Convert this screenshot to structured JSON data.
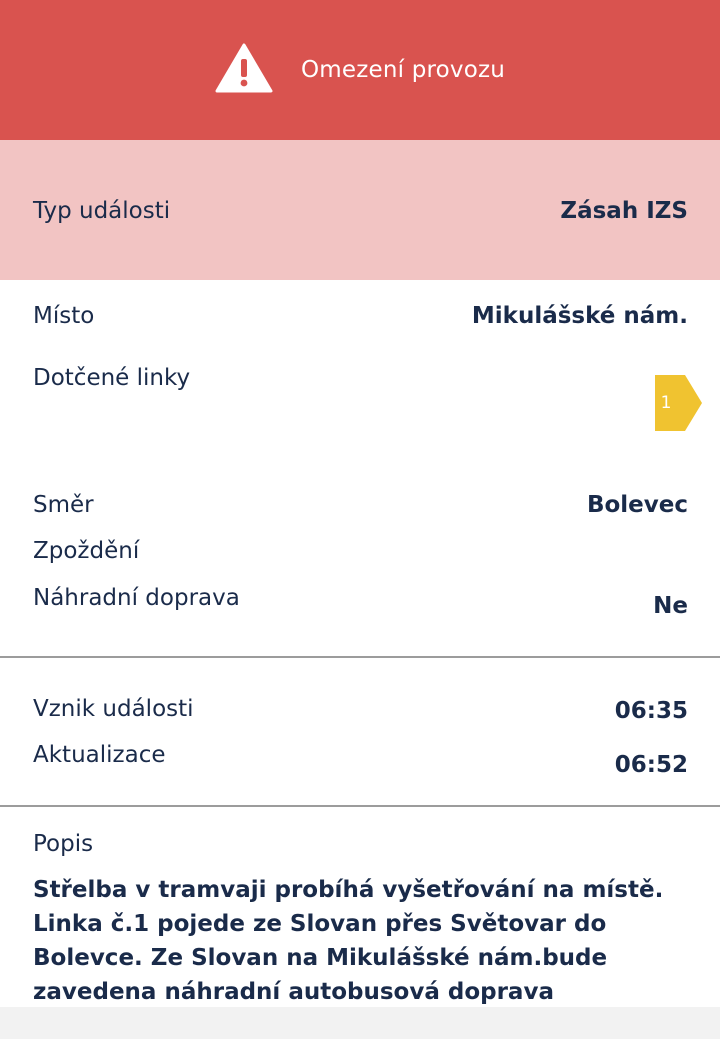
{
  "header": {
    "title": "Omezení provozu",
    "icon": "warning-icon",
    "color": "#d9534f"
  },
  "event_type": {
    "label": "Typ události",
    "value": "Zásah IZS"
  },
  "details": {
    "location_label": "Místo",
    "location_value": "Mikulášské nám.",
    "lines_label": "Dotčené linky",
    "lines": [
      {
        "number": "1",
        "color": "#f0c330"
      }
    ],
    "direction_label": "Směr",
    "direction_value": "Bolevec",
    "delay_label": "Zpoždění",
    "delay_value": "",
    "replacement_label": "Náhradní doprava",
    "replacement_value": "Ne"
  },
  "times": {
    "created_label": "Vznik události",
    "created_value": "06:35",
    "updated_label": "Aktualizace",
    "updated_value": "06:52"
  },
  "description": {
    "label": "Popis",
    "text": "Střelba v tramvaji probíhá vyšetřování na místě. Linka č.1 pojede ze Slovan přes Světovar do Bolevce. Ze Slovan na Mikulášské nám.bude zavedena náhradní autobusová doprava"
  }
}
